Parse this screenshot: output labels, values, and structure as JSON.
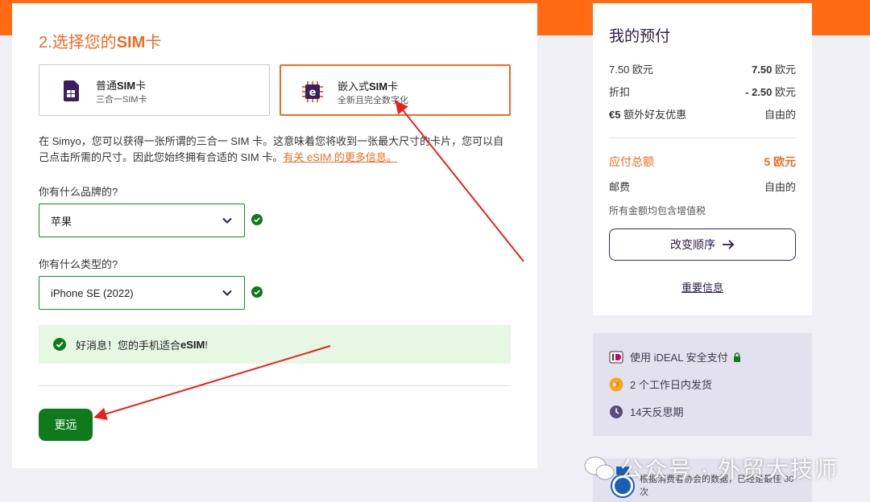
{
  "step": {
    "number": "2.",
    "title_prefix": "选择您的",
    "title_bold": "SIM",
    "title_suffix": "卡"
  },
  "sim_options": [
    {
      "name_prefix": "普通",
      "name_bold": "SIM",
      "name_suffix": "卡",
      "sub": "三合一SIM卡",
      "selected": false,
      "icon": "sim-card-icon"
    },
    {
      "name_prefix": "嵌入式",
      "name_bold": "SIM",
      "name_suffix": "卡",
      "sub": "全新且完全数字化",
      "selected": true,
      "icon": "esim-chip-icon"
    }
  ],
  "description": {
    "text": "在 Simyo，您可以获得一张所谓的三合一 SIM 卡。这意味着您将收到一张最大尺寸的卡片，您可以自己点击所需的尺寸。因此您始终拥有合适的 SIM 卡。",
    "link": "有关 eSIM 的更多信息。"
  },
  "brand_question": {
    "label": "你有什么品牌的?",
    "value": "苹果"
  },
  "type_question": {
    "label": "你有什么类型的?",
    "value": "iPhone SE (2022)"
  },
  "good_news": {
    "text_prefix": "好消息！您的手机适合 ",
    "text_bold": "eSIM",
    "text_suffix": "!"
  },
  "next_button": "更远",
  "summary": {
    "title": "我的预付",
    "rows": [
      {
        "label": "7.50 欧元",
        "value_bold": "7.50",
        "value_suffix": " 欧元"
      },
      {
        "label": "折扣",
        "value_bold": "- 2.50",
        "value_suffix": " 欧元"
      },
      {
        "label_bold": "€5",
        "label_suffix": " 额外好友优惠",
        "value": "自由的"
      }
    ],
    "total": {
      "label": "应付总额",
      "value_bold": "5",
      "value_suffix": " 欧元"
    },
    "shipping": {
      "label": "邮费",
      "value": "自由的"
    },
    "vat_note": "所有金额均包含增值税",
    "change_button": "改变顺序",
    "info_link": "重要信息"
  },
  "features": [
    {
      "text": "使用 iDEAL 安全支付",
      "icon": "ideal-icon"
    },
    {
      "text": "2 个工作日内发货",
      "icon": "postnl-icon"
    },
    {
      "text": "14天反思期",
      "icon": "clock-icon"
    }
  ],
  "badge_text": "根据消费者协会的数据，已经是最佳 30 次",
  "watermark": "公众号 · 外贸大技师",
  "colors": {
    "accent": "#f26a21",
    "green": "#0f7a1c",
    "purple": "#2b1d44"
  }
}
